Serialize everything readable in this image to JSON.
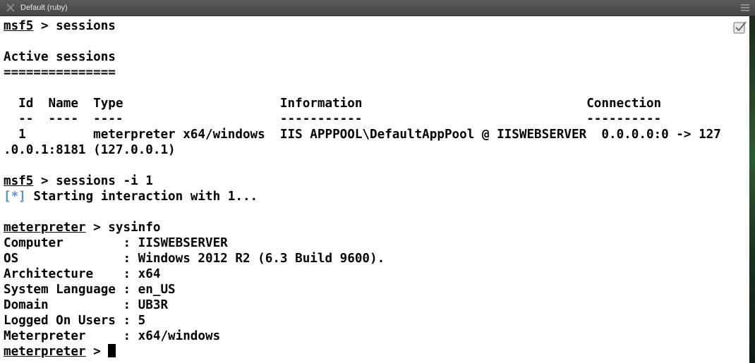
{
  "window": {
    "title": "Default (ruby)",
    "close_icon": "close-icon",
    "menu_icon": "hamburger-menu-icon",
    "marks_icon": "bookmark-check-icon"
  },
  "colors": {
    "titlebar": "#4e4e4e",
    "background": "#ffffff",
    "text": "#000000",
    "info_marker": "#5b8fd0"
  },
  "terminal": {
    "lines": [
      {
        "prompt": "msf5",
        "rest": " > sessions"
      },
      {
        "text": "Active sessions"
      },
      {
        "text": "==============="
      },
      {
        "text": "  Id  Name  Type                     Information                              Connection"
      },
      {
        "text": "  --  ----  ----                     -----------                              ----------"
      },
      {
        "text": "  1         meterpreter x64/windows  IIS APPPOOL\\DefaultAppPool @ IISWEBSERVER  0.0.0.0:0 -> 127"
      },
      {
        "text": ".0.0.1:8181 (127.0.0.1)"
      },
      {
        "prompt": "msf5",
        "rest": " > sessions -i 1"
      },
      {
        "marker": "[*]",
        "rest": " Starting interaction with 1..."
      },
      {
        "prompt": "meterpreter",
        "rest": " > sysinfo"
      },
      {
        "text": "Computer        : IISWEBSERVER"
      },
      {
        "text": "OS              : Windows 2012 R2 (6.3 Build 9600)."
      },
      {
        "text": "Architecture    : x64"
      },
      {
        "text": "System Language : en_US"
      },
      {
        "text": "Domain          : UB3R"
      },
      {
        "text": "Logged On Users : 5"
      },
      {
        "text": "Meterpreter     : x64/windows"
      },
      {
        "prompt": "meterpreter",
        "rest": " > "
      }
    ]
  }
}
